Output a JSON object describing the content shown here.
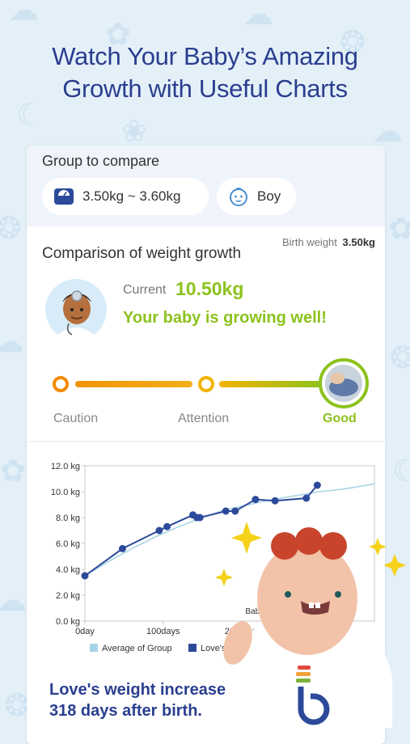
{
  "headline": {
    "line1": "Watch Your Baby’s Amazing",
    "line2": "Growth with Useful Charts"
  },
  "group": {
    "title": "Group to compare",
    "weight_range": "3.50kg ~ 3.60kg",
    "weight_icon": "scale-icon",
    "gender": "Boy",
    "gender_icon": "baby-face-icon"
  },
  "comparison": {
    "title": "Comparison of weight growth",
    "birth_weight_label": "Birth weight",
    "birth_weight_value": "3.50kg",
    "current_label": "Current",
    "current_value": "10.50kg",
    "status_message": "Your baby is growing well!",
    "levels": [
      "Caution",
      "Attention",
      "Good"
    ],
    "active_level": "Good",
    "colors": {
      "good": "#8cc21d",
      "caution": "#f28a00",
      "attention": "#f2b300"
    }
  },
  "chart_data": {
    "type": "line",
    "x_unit": "days",
    "xlim": [
      0,
      370
    ],
    "ylim": [
      0,
      12
    ],
    "y_ticks": [
      "0.0 kg",
      "2.0 kg",
      "4.0 kg",
      "6.0 kg",
      "8.0 kg",
      "10.0 kg",
      "12.0 kg"
    ],
    "x_ticks": [
      {
        "value": 0,
        "label": "0day"
      },
      {
        "value": 100,
        "label": "100days"
      },
      {
        "value": 200,
        "label": "200days"
      }
    ],
    "series": [
      {
        "name": "Average of Group",
        "color": "#a8d4e6",
        "x": [
          0,
          30,
          60,
          90,
          120,
          150,
          180,
          210,
          240,
          270,
          300,
          330,
          370
        ],
        "y": [
          3.5,
          4.6,
          5.6,
          6.5,
          7.3,
          8.0,
          8.6,
          9.0,
          9.4,
          9.7,
          10.0,
          10.2,
          10.6
        ]
      },
      {
        "name": "Love's weight",
        "color": "#2d4a9a",
        "x": [
          0,
          48,
          95,
          105,
          138,
          143,
          147,
          180,
          192,
          218,
          243,
          283,
          297
        ],
        "y": [
          3.5,
          5.6,
          7.0,
          7.3,
          8.2,
          8.0,
          8.0,
          8.5,
          8.5,
          9.4,
          9.3,
          9.5,
          10.5
        ]
      }
    ],
    "legend": [
      "Average of Group",
      "Love's weight"
    ],
    "legend_position": "bottom",
    "annotation": "Baby's"
  },
  "summary": {
    "line1": "Love's weight increased by",
    "line2": "318 days after birth."
  }
}
